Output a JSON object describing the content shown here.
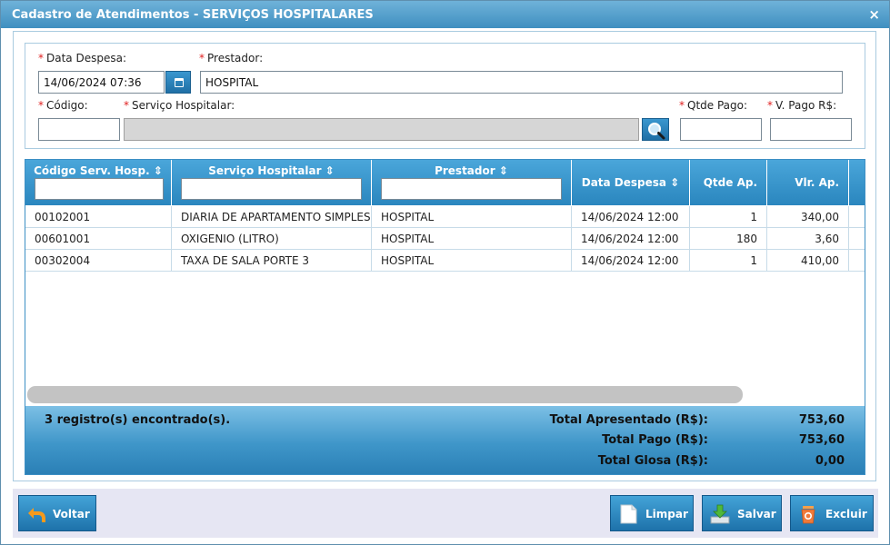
{
  "window": {
    "title": "Cadastro de Atendimentos - SERVIÇOS HOSPITALARES",
    "close_label": "×"
  },
  "form": {
    "data_despesa": {
      "label": "Data Despesa:",
      "value": "14/06/2024 07:36"
    },
    "prestador": {
      "label": "Prestador:",
      "value": "HOSPITAL"
    },
    "codigo": {
      "label": "Código:",
      "value": ""
    },
    "servico": {
      "label": "Serviço Hospitalar:",
      "value": ""
    },
    "qtde_pago": {
      "label": "Qtde Pago:",
      "value": ""
    },
    "v_pago": {
      "label": "V. Pago R$:",
      "value": ""
    },
    "required_mark": "*"
  },
  "grid": {
    "columns": [
      {
        "label": "Código Serv. Hosp.",
        "sort": "⇕"
      },
      {
        "label": "Serviço Hospitalar",
        "sort": "⇕"
      },
      {
        "label": "Prestador",
        "sort": "⇕"
      },
      {
        "label": "Data Despesa",
        "sort": "⇕"
      },
      {
        "label": "Qtde Ap."
      },
      {
        "label": "Vlr. Ap."
      }
    ],
    "rows": [
      {
        "codigo": "00102001",
        "servico": "DIARIA DE APARTAMENTO SIMPLES",
        "prestador": "HOSPITAL",
        "data": "14/06/2024 12:00",
        "qtde": "1",
        "vlr": "340,00"
      },
      {
        "codigo": "00601001",
        "servico": "OXIGENIO (LITRO)",
        "prestador": "HOSPITAL",
        "data": "14/06/2024 12:00",
        "qtde": "180",
        "vlr": "3,60"
      },
      {
        "codigo": "00302004",
        "servico": "TAXA DE SALA PORTE 3",
        "prestador": "HOSPITAL",
        "data": "14/06/2024 12:00",
        "qtde": "1",
        "vlr": "410,00"
      }
    ],
    "footer": {
      "records": "3 registro(s) encontrado(s).",
      "total_apresentado_label": "Total Apresentado (R$):",
      "total_apresentado": "753,60",
      "total_pago_label": "Total Pago (R$):",
      "total_pago": "753,60",
      "total_glosa_label": "Total Glosa (R$):",
      "total_glosa": "0,00"
    }
  },
  "buttons": {
    "voltar": "Voltar",
    "limpar": "Limpar",
    "salvar": "Salvar",
    "excluir": "Excluir"
  },
  "colors": {
    "header": "#3a97cf",
    "required": "#e02020",
    "footer": "#3f96c9"
  }
}
